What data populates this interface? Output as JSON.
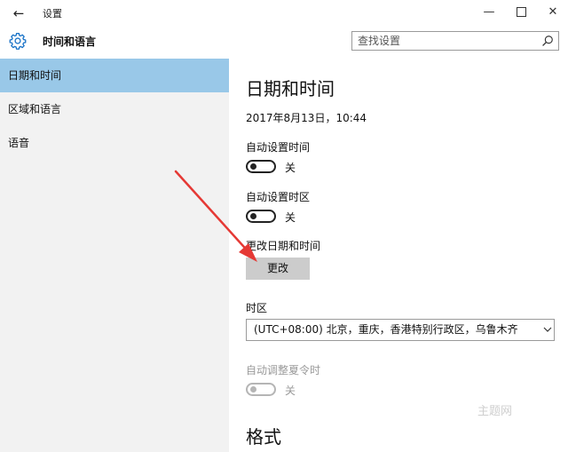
{
  "window": {
    "title": "设置",
    "back_icon": "arrow-left-icon",
    "minimize_glyph": "—",
    "close_glyph": "✕"
  },
  "header": {
    "section_title": "时间和语言",
    "section_icon": "gear-icon"
  },
  "search": {
    "placeholder": "查找设置",
    "icon": "search-icon"
  },
  "sidebar": {
    "active_color": "#99c8e8",
    "items": [
      {
        "label": "日期和时间",
        "active": true
      },
      {
        "label": "区域和语言",
        "active": false
      },
      {
        "label": "语音",
        "active": false
      }
    ]
  },
  "main": {
    "page_title": "日期和时间",
    "current_datetime": "2017年8月13日，10:44",
    "auto_time": {
      "label": "自动设置时间",
      "state": "关",
      "on": false
    },
    "auto_timezone": {
      "label": "自动设置时区",
      "state": "关",
      "on": false
    },
    "change_datetime": {
      "label": "更改日期和时间",
      "button": "更改"
    },
    "timezone": {
      "label": "时区",
      "value": "(UTC+08:00) 北京，重庆，香港特别行政区，乌鲁木齐"
    },
    "dst": {
      "label": "自动调整夏令时",
      "state": "关",
      "on": false,
      "disabled": true
    },
    "format_title": "格式"
  },
  "annotation": {
    "arrow_color": "#e53935"
  },
  "watermark": {
    "text": "主题网"
  }
}
